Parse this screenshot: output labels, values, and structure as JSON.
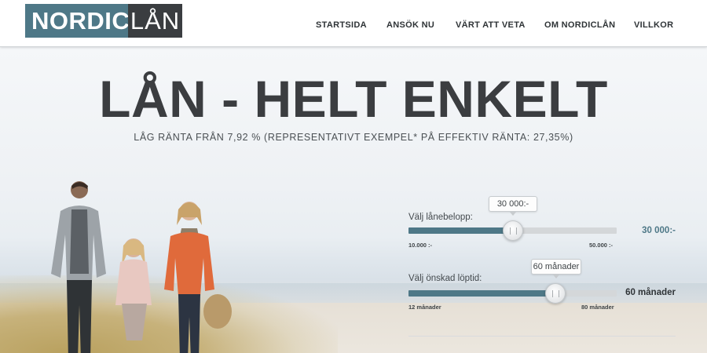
{
  "logo": {
    "part1": "NORDIC",
    "part2": "LÅN",
    "accent_color": "#4e7887",
    "dark_color": "#3a3d40"
  },
  "nav": {
    "items": [
      {
        "label": "STARTSIDA"
      },
      {
        "label": "ANSÖK NU"
      },
      {
        "label": "VÄRT ATT VETA"
      },
      {
        "label": "OM NORDICLÅN"
      },
      {
        "label": "VILLKOR"
      }
    ]
  },
  "hero": {
    "title": "LÅN - HELT ENKELT",
    "subtitle": "LÅG RÄNTA FRÅN 7,92 % (REPRESENTATIVT EXEMPEL* PÅ EFFEKTIV RÄNTA: 27,35%)"
  },
  "calculator": {
    "amount": {
      "label": "Välj lånebelopp:",
      "tooltip": "30 000:-",
      "display_value": "30 000:-",
      "min_label": "10.000 :-",
      "max_label": "50.000 :-",
      "fraction": 0.5
    },
    "term": {
      "label": "Välj önskad löptid:",
      "tooltip": "60 månader",
      "display_value": "60 månader",
      "min_label": "12 månader",
      "max_label": "80 månader",
      "fraction": 0.706
    }
  },
  "colors": {
    "accent": "#4e7887",
    "text_dark": "#3b3d40"
  }
}
